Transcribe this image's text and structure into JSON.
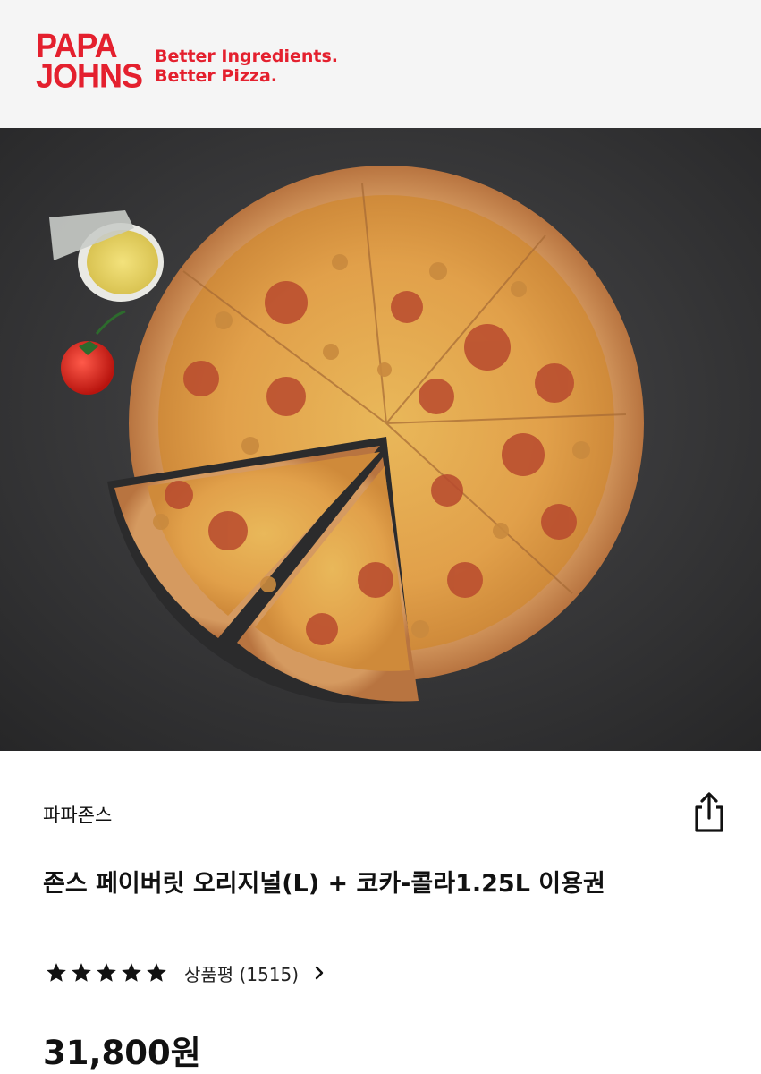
{
  "banner": {
    "logo_line1": "PAPA",
    "logo_line2": "JOHNS",
    "tagline_line1": "Better Ingredients.",
    "tagline_line2": "Better Pizza.",
    "brand_color": "#e4202e"
  },
  "product": {
    "brand": "파파존스",
    "title": "존스 페이버릿 오리지널(L) + 코카-콜라1.25L 이용권",
    "rating": 5,
    "review_label": "상품평 (1515)",
    "price": "31,800원"
  },
  "icons": {
    "share": "share-icon",
    "star": "star-icon",
    "chevron": "chevron-right-icon"
  }
}
